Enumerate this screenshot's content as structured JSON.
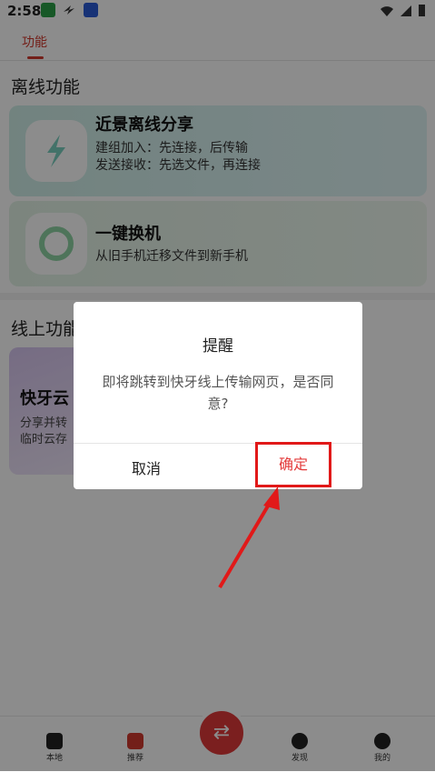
{
  "statusbar": {
    "time": "2:58",
    "icons_left": [
      "app-7-icon",
      "bolt-icon",
      "shield-app-icon"
    ],
    "icons_right": [
      "wifi-icon",
      "signal-icon",
      "battery-icon"
    ]
  },
  "tabs": {
    "active": "功能"
  },
  "offline": {
    "title": "离线功能",
    "card1": {
      "title": "近景离线分享",
      "line1": "建组加入：先连接，后传输",
      "line2": "发送接收：先选文件，再连接"
    },
    "card2": {
      "title": "一键换机",
      "line1": "从旧手机迁移文件到新手机"
    }
  },
  "online": {
    "title": "线上功能",
    "card3": {
      "title": "快牙云",
      "line1": "分享并转",
      "line2": "临时云存"
    }
  },
  "bottomnav": [
    {
      "label": "本地",
      "icon": "grid-icon"
    },
    {
      "label": "推荐",
      "icon": "star-bookmark-icon"
    },
    {
      "label": "发现",
      "icon": "planet-icon"
    },
    {
      "label": "我的",
      "icon": "face-icon"
    }
  ],
  "dialog": {
    "title": "提醒",
    "message": "即将跳转到快牙线上传输网页，是否同意?",
    "cancel": "取消",
    "confirm": "确定"
  },
  "colors": {
    "accent": "#d23a2e",
    "highlight": "#e11919"
  }
}
